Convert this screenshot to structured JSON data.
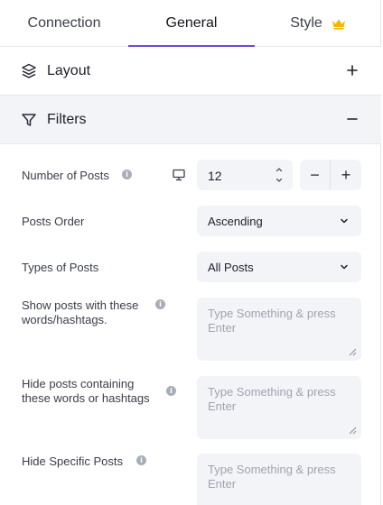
{
  "tabs": [
    {
      "label": "Connection"
    },
    {
      "label": "General"
    },
    {
      "label": "Style"
    }
  ],
  "sections": {
    "layout": {
      "title": "Layout",
      "toggle": "+"
    },
    "filters": {
      "title": "Filters",
      "toggle": "−"
    }
  },
  "fields": {
    "num_posts": {
      "label": "Number of Posts",
      "value": "12",
      "minus": "−",
      "plus": "+"
    },
    "posts_order": {
      "label": "Posts Order",
      "value": "Ascending"
    },
    "types_of_posts": {
      "label": "Types of Posts",
      "value": "All Posts"
    },
    "show_posts": {
      "label_line1": "Show posts with these",
      "label_line2": "words/hashtags.",
      "placeholder": "Type Something & press Enter"
    },
    "hide_posts": {
      "label_line1": "Hide posts containing",
      "label_line2": "these words or hashtags",
      "placeholder": "Type Something & press Enter"
    },
    "hide_specific": {
      "label": "Hide Specific Posts",
      "placeholder": "Type Something & press Enter"
    }
  },
  "icons": {
    "info": "i",
    "crown_color": "#f5b400",
    "accent": "#6b4ad8"
  }
}
